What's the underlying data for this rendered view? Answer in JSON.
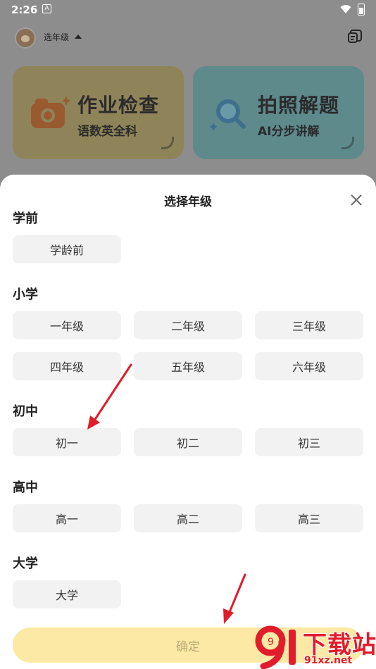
{
  "status_bar": {
    "time": "2:26",
    "notification_letter": "A"
  },
  "header": {
    "grade_select_label": "选年级"
  },
  "feature_cards": [
    {
      "title": "作业检查",
      "subtitle": "语数英全科",
      "icon": "camera-icon"
    },
    {
      "title": "拍照解题",
      "subtitle": "AI分步讲解",
      "icon": "magnifier-icon"
    }
  ],
  "sheet": {
    "title": "选择年级",
    "sections": [
      {
        "label": "学前",
        "options": [
          "学龄前"
        ]
      },
      {
        "label": "小学",
        "options": [
          "一年级",
          "二年级",
          "三年级",
          "四年级",
          "五年级",
          "六年级"
        ]
      },
      {
        "label": "初中",
        "options": [
          "初一",
          "初二",
          "初三"
        ]
      },
      {
        "label": "高中",
        "options": [
          "高一",
          "高二",
          "高三"
        ]
      },
      {
        "label": "大学",
        "options": [
          "大学"
        ]
      }
    ],
    "confirm_label": "确定"
  },
  "watermark": {
    "digits": "9",
    "text": "下载站",
    "url": "91xz.net"
  },
  "colors": {
    "accent_confirm": "#fbe9a5",
    "chip_bg": "#f2f2f2",
    "arrow": "#e11d2b",
    "overlay": "#8a8a8a"
  }
}
